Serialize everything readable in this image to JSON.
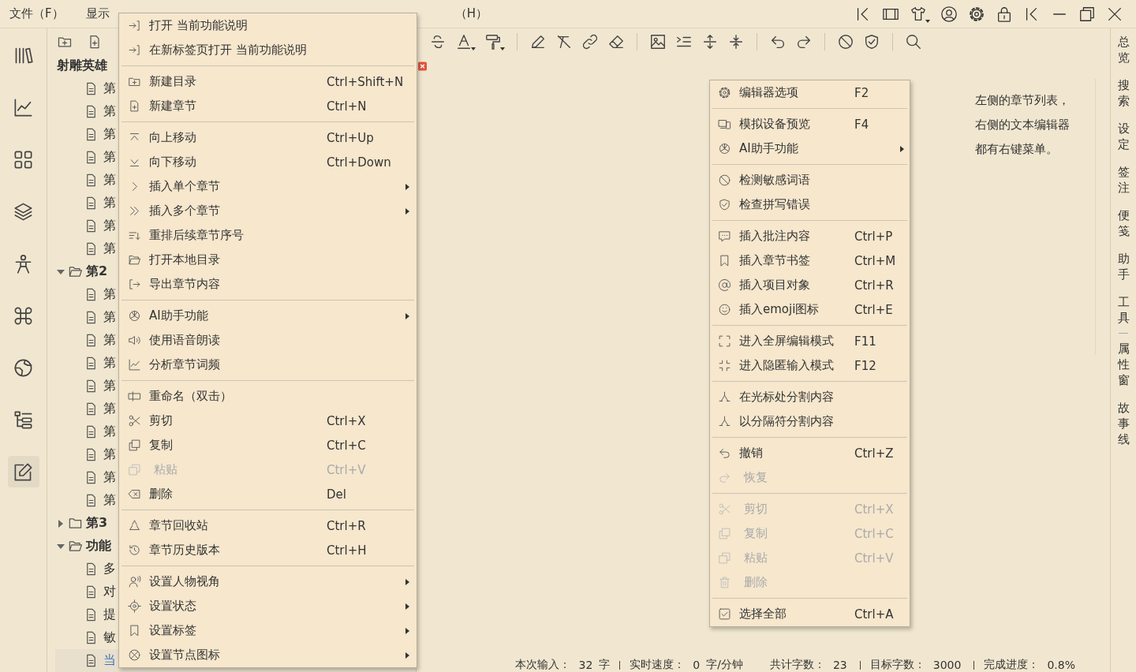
{
  "menubar": [
    {
      "label": "文件（F）"
    },
    {
      "label": "显示"
    },
    {
      "label": "（H）"
    }
  ],
  "rail": [
    {
      "selected": false
    },
    {
      "selected": false
    },
    {
      "selected": false
    },
    {
      "selected": false
    },
    {
      "selected": false
    },
    {
      "selected": false
    },
    {
      "selected": false
    },
    {
      "selected": false
    },
    {
      "selected": true
    }
  ],
  "tree": {
    "nodes": [
      {
        "kind": "book",
        "label": "射雕英雄",
        "selected": false,
        "children": [
          {
            "kind": "file",
            "label": "第",
            "selected": false
          },
          {
            "kind": "file",
            "label": "第",
            "selected": false
          },
          {
            "kind": "file",
            "label": "第",
            "selected": false
          },
          {
            "kind": "file",
            "label": "第",
            "selected": false
          },
          {
            "kind": "file",
            "label": "第",
            "selected": false
          },
          {
            "kind": "file",
            "label": "第",
            "selected": false
          },
          {
            "kind": "file",
            "label": "第",
            "selected": false
          },
          {
            "kind": "file",
            "label": "第",
            "selected": false
          }
        ]
      },
      {
        "kind": "folder",
        "label": "第2",
        "expanded": true,
        "selected": false,
        "children": [
          {
            "kind": "file",
            "label": "第",
            "selected": false
          },
          {
            "kind": "file",
            "label": "第",
            "selected": false
          },
          {
            "kind": "file",
            "label": "第",
            "selected": false
          },
          {
            "kind": "file",
            "label": "第",
            "selected": false
          },
          {
            "kind": "file",
            "label": "第",
            "selected": false
          },
          {
            "kind": "file",
            "label": "第",
            "selected": false
          },
          {
            "kind": "file",
            "label": "第",
            "selected": false
          },
          {
            "kind": "file",
            "label": "第",
            "selected": false
          },
          {
            "kind": "file",
            "label": "第",
            "selected": false
          },
          {
            "kind": "file",
            "label": "第",
            "selected": false
          }
        ]
      },
      {
        "kind": "folder",
        "label": "第3",
        "expanded": false,
        "selected": false
      },
      {
        "kind": "folder",
        "label": "功能",
        "expanded": true,
        "selected": false,
        "children": [
          {
            "kind": "file",
            "label": "多",
            "selected": false
          },
          {
            "kind": "file",
            "label": "对",
            "selected": false
          },
          {
            "kind": "file",
            "label": "提",
            "selected": false
          },
          {
            "kind": "file",
            "label": "敏",
            "selected": false
          },
          {
            "kind": "file",
            "label": "当",
            "selected": true
          }
        ]
      }
    ]
  },
  "editor": {
    "lines": [
      "左侧的章节列表，",
      "右侧的文本编辑器",
      "都有右键菜单。"
    ]
  },
  "right_tabs": [
    {
      "kind": "tab",
      "label": "总览"
    },
    {
      "kind": "tab",
      "label": "搜索"
    },
    {
      "kind": "tab",
      "label": "设定"
    },
    {
      "kind": "tab",
      "label": "签注"
    },
    {
      "kind": "tab",
      "label": "便笺"
    },
    {
      "kind": "tab",
      "label": "助手"
    },
    {
      "kind": "tab",
      "label": "工具"
    },
    {
      "kind": "divider"
    },
    {
      "kind": "tab",
      "label": "属性窗"
    },
    {
      "kind": "tab",
      "label": "故事线"
    }
  ],
  "status_bar": [
    {
      "label": "本次输入：",
      "value": "32",
      "unit": "字",
      "divider": true
    },
    {
      "label": "实时速度：",
      "value": "0",
      "unit": "字/分钟",
      "divider": false
    },
    {
      "label": "共计字数：",
      "value": "23",
      "divider": true
    },
    {
      "label": "目标字数：",
      "value": "3000",
      "divider": true
    },
    {
      "label": "完成进度：",
      "value": "0.8%",
      "divider": false
    }
  ],
  "context_menu_left": {
    "items": [
      {
        "kind": "item",
        "label": "打开 当前功能说明",
        "submenu": false,
        "disabled": false
      },
      {
        "kind": "item",
        "label": "在新标签页打开 当前功能说明",
        "submenu": false,
        "disabled": false
      },
      {
        "kind": "separator"
      },
      {
        "kind": "item",
        "label": "新建目录",
        "shortcut": "Ctrl+Shift+N",
        "submenu": false,
        "disabled": false
      },
      {
        "kind": "item",
        "label": "新建章节",
        "shortcut": "Ctrl+N",
        "submenu": false,
        "disabled": false
      },
      {
        "kind": "separator"
      },
      {
        "kind": "item",
        "label": "向上移动",
        "shortcut": "Ctrl+Up",
        "submenu": false,
        "disabled": false
      },
      {
        "kind": "item",
        "label": "向下移动",
        "shortcut": "Ctrl+Down",
        "submenu": false,
        "disabled": false
      },
      {
        "kind": "item",
        "label": "插入单个章节",
        "submenu": true,
        "disabled": false
      },
      {
        "kind": "item",
        "label": "插入多个章节",
        "submenu": true,
        "disabled": false
      },
      {
        "kind": "item",
        "label": "重排后续章节序号",
        "submenu": false,
        "disabled": false
      },
      {
        "kind": "item",
        "label": "打开本地目录",
        "submenu": false,
        "disabled": false
      },
      {
        "kind": "item",
        "label": "导出章节内容",
        "submenu": false,
        "disabled": false
      },
      {
        "kind": "separator"
      },
      {
        "kind": "item",
        "label": "AI助手功能",
        "submenu": true,
        "disabled": false
      },
      {
        "kind": "item",
        "label": "使用语音朗读",
        "submenu": false,
        "disabled": false
      },
      {
        "kind": "item",
        "label": "分析章节词频",
        "submenu": false,
        "disabled": false
      },
      {
        "kind": "separator"
      },
      {
        "kind": "item",
        "label": "重命名（双击）",
        "submenu": false,
        "disabled": false
      },
      {
        "kind": "item",
        "label": "剪切",
        "shortcut": "Ctrl+X",
        "submenu": false,
        "disabled": false
      },
      {
        "kind": "item",
        "label": "复制",
        "shortcut": "Ctrl+C",
        "submenu": false,
        "disabled": false
      },
      {
        "kind": "item",
        "label": "粘贴",
        "shortcut": "Ctrl+V",
        "submenu": false,
        "disabled": true
      },
      {
        "kind": "item",
        "label": "删除",
        "shortcut": "Del",
        "submenu": false,
        "disabled": false
      },
      {
        "kind": "separator"
      },
      {
        "kind": "item",
        "label": "章节回收站",
        "shortcut": "Ctrl+R",
        "submenu": false,
        "disabled": false
      },
      {
        "kind": "item",
        "label": "章节历史版本",
        "shortcut": "Ctrl+H",
        "submenu": false,
        "disabled": false
      },
      {
        "kind": "separator"
      },
      {
        "kind": "item",
        "label": "设置人物视角",
        "submenu": true,
        "disabled": false
      },
      {
        "kind": "item",
        "label": "设置状态",
        "submenu": true,
        "disabled": false
      },
      {
        "kind": "item",
        "label": "设置标签",
        "submenu": true,
        "disabled": false
      },
      {
        "kind": "item",
        "label": "设置节点图标",
        "submenu": true,
        "disabled": false
      }
    ]
  },
  "context_menu_right": {
    "items": [
      {
        "kind": "item",
        "label": "编辑器选项",
        "shortcut": "F2",
        "submenu": false,
        "disabled": false
      },
      {
        "kind": "separator"
      },
      {
        "kind": "item",
        "label": "模拟设备预览",
        "shortcut": "F4",
        "submenu": false,
        "disabled": false
      },
      {
        "kind": "item",
        "label": "AI助手功能",
        "submenu": true,
        "disabled": false
      },
      {
        "kind": "separator"
      },
      {
        "kind": "item",
        "label": "检测敏感词语",
        "submenu": false,
        "disabled": false
      },
      {
        "kind": "item",
        "label": "检查拼写错误",
        "submenu": false,
        "disabled": false
      },
      {
        "kind": "separator"
      },
      {
        "kind": "item",
        "label": "插入批注内容",
        "shortcut": "Ctrl+P",
        "submenu": false,
        "disabled": false
      },
      {
        "kind": "item",
        "label": "插入章节书签",
        "shortcut": "Ctrl+M",
        "submenu": false,
        "disabled": false
      },
      {
        "kind": "item",
        "label": "插入项目对象",
        "shortcut": "Ctrl+R",
        "submenu": false,
        "disabled": false
      },
      {
        "kind": "item",
        "label": "插入emoji图标",
        "shortcut": "Ctrl+E",
        "submenu": false,
        "disabled": false
      },
      {
        "kind": "separator"
      },
      {
        "kind": "item",
        "label": "进入全屏编辑模式",
        "shortcut": "F11",
        "submenu": false,
        "disabled": false
      },
      {
        "kind": "item",
        "label": "进入隐匿输入模式",
        "shortcut": "F12",
        "submenu": false,
        "disabled": false
      },
      {
        "kind": "separator"
      },
      {
        "kind": "item",
        "label": "在光标处分割内容",
        "submenu": false,
        "disabled": false
      },
      {
        "kind": "item",
        "label": "以分隔符分割内容",
        "submenu": false,
        "disabled": false
      },
      {
        "kind": "separator"
      },
      {
        "kind": "item",
        "label": "撤销",
        "shortcut": "Ctrl+Z",
        "submenu": false,
        "disabled": false
      },
      {
        "kind": "item",
        "label": "恢复",
        "submenu": false,
        "disabled": true
      },
      {
        "kind": "separator"
      },
      {
        "kind": "item",
        "label": "剪切",
        "shortcut": "Ctrl+X",
        "submenu": false,
        "disabled": true
      },
      {
        "kind": "item",
        "label": "复制",
        "shortcut": "Ctrl+C",
        "submenu": false,
        "disabled": true
      },
      {
        "kind": "item",
        "label": "粘贴",
        "shortcut": "Ctrl+V",
        "submenu": false,
        "disabled": true
      },
      {
        "kind": "item",
        "label": "删除",
        "submenu": false,
        "disabled": true
      },
      {
        "kind": "separator"
      },
      {
        "kind": "item",
        "label": "选择全部",
        "shortcut": "Ctrl+A",
        "submenu": false,
        "disabled": false
      }
    ]
  }
}
